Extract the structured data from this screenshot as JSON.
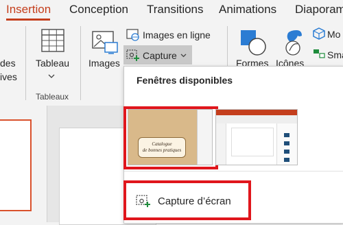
{
  "tabs": [
    {
      "label": "Insertion",
      "active": true
    },
    {
      "label": "Conception"
    },
    {
      "label": "Transitions"
    },
    {
      "label": "Animations"
    },
    {
      "label": "Diaporama"
    }
  ],
  "ribbon": {
    "partial_left_line1": "des",
    "partial_left_line2": "ives",
    "tableau": "Tableau",
    "tableaux_group": "Tableaux",
    "images": "Images",
    "images_en_ligne": "Images en ligne",
    "capture": "Capture",
    "formes": "Formes",
    "icones": "Icônes",
    "partial_right_1": "Mo",
    "partial_right_2": "Sma"
  },
  "dropdown": {
    "title": "Fenêtres disponibles",
    "window_1_text_line1": "Catalogue",
    "window_1_text_line2": "de bonnes pratiques",
    "capture_screen": "Capture d’écran"
  },
  "colors": {
    "accent": "#c43e1c",
    "highlight_red": "#e0161c",
    "icon_blue": "#2b7cd3",
    "icon_green": "#1e8c3c"
  }
}
